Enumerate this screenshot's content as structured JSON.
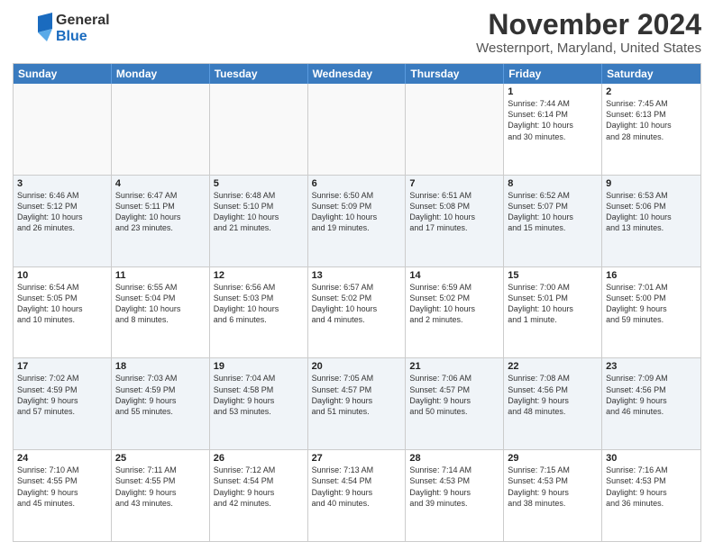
{
  "header": {
    "logo_line1": "General",
    "logo_line2": "Blue",
    "title": "November 2024",
    "subtitle": "Westernport, Maryland, United States"
  },
  "calendar": {
    "days_of_week": [
      "Sunday",
      "Monday",
      "Tuesday",
      "Wednesday",
      "Thursday",
      "Friday",
      "Saturday"
    ],
    "weeks": [
      [
        {
          "day": "",
          "info": "",
          "empty": true
        },
        {
          "day": "",
          "info": "",
          "empty": true
        },
        {
          "day": "",
          "info": "",
          "empty": true
        },
        {
          "day": "",
          "info": "",
          "empty": true
        },
        {
          "day": "",
          "info": "",
          "empty": true
        },
        {
          "day": "1",
          "info": "Sunrise: 7:44 AM\nSunset: 6:14 PM\nDaylight: 10 hours\nand 30 minutes.",
          "empty": false
        },
        {
          "day": "2",
          "info": "Sunrise: 7:45 AM\nSunset: 6:13 PM\nDaylight: 10 hours\nand 28 minutes.",
          "empty": false
        }
      ],
      [
        {
          "day": "3",
          "info": "Sunrise: 6:46 AM\nSunset: 5:12 PM\nDaylight: 10 hours\nand 26 minutes.",
          "empty": false
        },
        {
          "day": "4",
          "info": "Sunrise: 6:47 AM\nSunset: 5:11 PM\nDaylight: 10 hours\nand 23 minutes.",
          "empty": false
        },
        {
          "day": "5",
          "info": "Sunrise: 6:48 AM\nSunset: 5:10 PM\nDaylight: 10 hours\nand 21 minutes.",
          "empty": false
        },
        {
          "day": "6",
          "info": "Sunrise: 6:50 AM\nSunset: 5:09 PM\nDaylight: 10 hours\nand 19 minutes.",
          "empty": false
        },
        {
          "day": "7",
          "info": "Sunrise: 6:51 AM\nSunset: 5:08 PM\nDaylight: 10 hours\nand 17 minutes.",
          "empty": false
        },
        {
          "day": "8",
          "info": "Sunrise: 6:52 AM\nSunset: 5:07 PM\nDaylight: 10 hours\nand 15 minutes.",
          "empty": false
        },
        {
          "day": "9",
          "info": "Sunrise: 6:53 AM\nSunset: 5:06 PM\nDaylight: 10 hours\nand 13 minutes.",
          "empty": false
        }
      ],
      [
        {
          "day": "10",
          "info": "Sunrise: 6:54 AM\nSunset: 5:05 PM\nDaylight: 10 hours\nand 10 minutes.",
          "empty": false
        },
        {
          "day": "11",
          "info": "Sunrise: 6:55 AM\nSunset: 5:04 PM\nDaylight: 10 hours\nand 8 minutes.",
          "empty": false
        },
        {
          "day": "12",
          "info": "Sunrise: 6:56 AM\nSunset: 5:03 PM\nDaylight: 10 hours\nand 6 minutes.",
          "empty": false
        },
        {
          "day": "13",
          "info": "Sunrise: 6:57 AM\nSunset: 5:02 PM\nDaylight: 10 hours\nand 4 minutes.",
          "empty": false
        },
        {
          "day": "14",
          "info": "Sunrise: 6:59 AM\nSunset: 5:02 PM\nDaylight: 10 hours\nand 2 minutes.",
          "empty": false
        },
        {
          "day": "15",
          "info": "Sunrise: 7:00 AM\nSunset: 5:01 PM\nDaylight: 10 hours\nand 1 minute.",
          "empty": false
        },
        {
          "day": "16",
          "info": "Sunrise: 7:01 AM\nSunset: 5:00 PM\nDaylight: 9 hours\nand 59 minutes.",
          "empty": false
        }
      ],
      [
        {
          "day": "17",
          "info": "Sunrise: 7:02 AM\nSunset: 4:59 PM\nDaylight: 9 hours\nand 57 minutes.",
          "empty": false
        },
        {
          "day": "18",
          "info": "Sunrise: 7:03 AM\nSunset: 4:59 PM\nDaylight: 9 hours\nand 55 minutes.",
          "empty": false
        },
        {
          "day": "19",
          "info": "Sunrise: 7:04 AM\nSunset: 4:58 PM\nDaylight: 9 hours\nand 53 minutes.",
          "empty": false
        },
        {
          "day": "20",
          "info": "Sunrise: 7:05 AM\nSunset: 4:57 PM\nDaylight: 9 hours\nand 51 minutes.",
          "empty": false
        },
        {
          "day": "21",
          "info": "Sunrise: 7:06 AM\nSunset: 4:57 PM\nDaylight: 9 hours\nand 50 minutes.",
          "empty": false
        },
        {
          "day": "22",
          "info": "Sunrise: 7:08 AM\nSunset: 4:56 PM\nDaylight: 9 hours\nand 48 minutes.",
          "empty": false
        },
        {
          "day": "23",
          "info": "Sunrise: 7:09 AM\nSunset: 4:56 PM\nDaylight: 9 hours\nand 46 minutes.",
          "empty": false
        }
      ],
      [
        {
          "day": "24",
          "info": "Sunrise: 7:10 AM\nSunset: 4:55 PM\nDaylight: 9 hours\nand 45 minutes.",
          "empty": false
        },
        {
          "day": "25",
          "info": "Sunrise: 7:11 AM\nSunset: 4:55 PM\nDaylight: 9 hours\nand 43 minutes.",
          "empty": false
        },
        {
          "day": "26",
          "info": "Sunrise: 7:12 AM\nSunset: 4:54 PM\nDaylight: 9 hours\nand 42 minutes.",
          "empty": false
        },
        {
          "day": "27",
          "info": "Sunrise: 7:13 AM\nSunset: 4:54 PM\nDaylight: 9 hours\nand 40 minutes.",
          "empty": false
        },
        {
          "day": "28",
          "info": "Sunrise: 7:14 AM\nSunset: 4:53 PM\nDaylight: 9 hours\nand 39 minutes.",
          "empty": false
        },
        {
          "day": "29",
          "info": "Sunrise: 7:15 AM\nSunset: 4:53 PM\nDaylight: 9 hours\nand 38 minutes.",
          "empty": false
        },
        {
          "day": "30",
          "info": "Sunrise: 7:16 AM\nSunset: 4:53 PM\nDaylight: 9 hours\nand 36 minutes.",
          "empty": false
        }
      ]
    ]
  }
}
